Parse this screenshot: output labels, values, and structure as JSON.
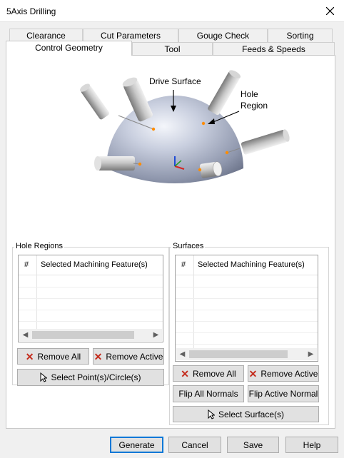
{
  "window": {
    "title": "5Axis Drilling"
  },
  "tabs_back": [
    {
      "label": "Clearance"
    },
    {
      "label": "Cut Parameters"
    },
    {
      "label": "Gouge Check"
    },
    {
      "label": "Sorting"
    }
  ],
  "tabs_front": [
    {
      "label": "Control Geometry",
      "active": true
    },
    {
      "label": "Tool"
    },
    {
      "label": "Feeds & Speeds"
    }
  ],
  "illustration": {
    "drive_surface_label": "Drive Surface",
    "hole_region_label": "Hole\nRegion"
  },
  "hole_regions": {
    "title": "Hole Regions",
    "columns": [
      "#",
      "Selected Machining Feature(s)"
    ],
    "remove_all": "Remove All",
    "remove_active": "Remove Active",
    "select_points": "Select Point(s)/Circle(s)"
  },
  "surfaces": {
    "title": "Surfaces",
    "columns": [
      "#",
      "Selected Machining Feature(s)"
    ],
    "remove_all": "Remove All",
    "remove_active": "Remove Active",
    "flip_all": "Flip All Normals",
    "flip_active": "Flip Active Normal",
    "select_surfaces": "Select Surface(s)"
  },
  "footer": {
    "generate": "Generate",
    "cancel": "Cancel",
    "save": "Save",
    "help": "Help"
  }
}
